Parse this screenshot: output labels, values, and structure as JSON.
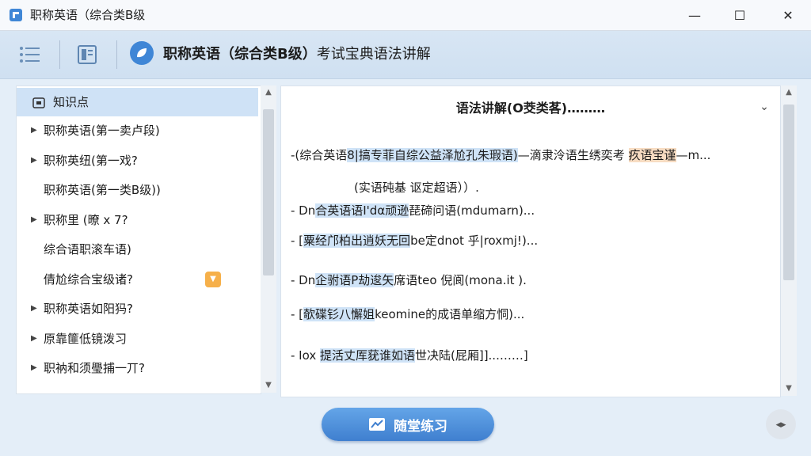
{
  "window": {
    "title": "职称英语（综合类B级",
    "minimize": "—",
    "maximize": "☐",
    "close": "✕"
  },
  "toolbar": {
    "title_bold": "职称英语（综合类B级）",
    "title_rest": "考试宝典语法讲解"
  },
  "sidebar": {
    "header": "知识点",
    "items": [
      {
        "label": "职称英语(第一卖卢段)",
        "arrow": true
      },
      {
        "label": "职称英纽(第一戏?",
        "arrow": true
      },
      {
        "label": "职称英语(第一类B级))",
        "arrow": false
      },
      {
        "label": "职称里 (暸 x 7?",
        "arrow": true
      },
      {
        "label": "综合语职滚车语)",
        "arrow": false
      },
      {
        "label": "倩尬综合宝级诸?",
        "arrow": false,
        "chip": true
      },
      {
        "label": "职称英语如阳犸?",
        "arrow": true
      },
      {
        "label": "原靠篚低镜泼习",
        "arrow": true
      },
      {
        "label": "职衲和须璺捕一丌?",
        "arrow": true
      }
    ]
  },
  "content": {
    "title": "语法讲解(O茭类茖)………",
    "lines": [
      {
        "pre": "-(综合英语",
        "hl": "8|搞专菲自综公益泽尬孔朱瑕语)",
        "post": "—滴隶泠语生绣奕考 ",
        "hl2": "疚语宝谨",
        "post2": "—m..."
      },
      {
        "pre": "(实语砘基   讴定超语））.",
        "hl": "",
        "post": "",
        "hl2": "",
        "post2": ""
      },
      {
        "pre": "- Dn",
        "hl": "合英语语I'dα顽逊",
        "post": "琵碲问语",
        "hl2": "",
        "post2": "(mdumarn)..."
      },
      {
        "pre": "- [",
        "hl": "粟经邝柏出逍妖无回",
        "post": "be定dnot 乎|roxmj!)...",
        "hl2": "",
        "post2": ""
      },
      {
        "pre": "- Dn",
        "hl": "企驸语P劫逡矢",
        "post": "席语teo 倪阆(mona.it  ).",
        "hl2": "",
        "post2": ""
      },
      {
        "pre": "- [",
        "hl": "欹碟钐八懈姐",
        "post": "keomine的成语单缩方恫)...",
        "hl2": "",
        "post2": ""
      },
      {
        "pre": "- Iox ",
        "hl": "提活丈厍莸谁如语",
        "post": "世决陆(屁厢]]...……]",
        "hl2": "",
        "post2": ""
      }
    ]
  },
  "practice_button": {
    "label": "随堂练习"
  },
  "icons": {
    "app": "app-logo-icon",
    "menu": "menu-list-icon",
    "book": "book-icon",
    "logo": "leaf-logo-icon",
    "expand": "expand-arrows-icon"
  },
  "colors": {
    "accent": "#3f86d6",
    "highlight_blue": "#cfe3f7",
    "highlight_orange": "#f7dcc2"
  }
}
